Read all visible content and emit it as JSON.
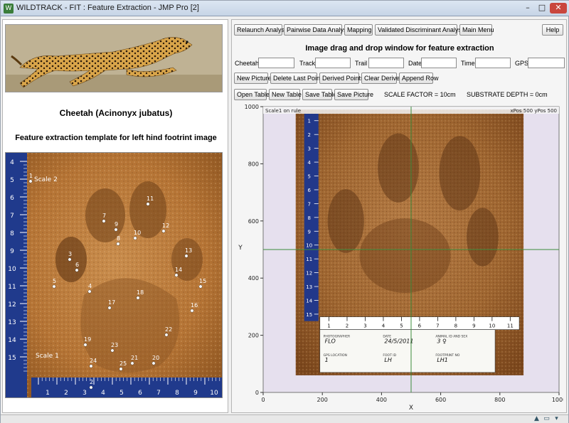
{
  "window": {
    "title": "WILDTRACK - FIT : Feature Extraction - JMP Pro [2]",
    "controls": {
      "minimize": "–",
      "maximize": "□",
      "close": "✕"
    }
  },
  "left_panel": {
    "species_title": "Cheetah (Acinonyx jubatus)",
    "template_title": "Feature extraction template for left hind footrint image",
    "scale_labels": {
      "scale2": "Scale 2",
      "scale1": "Scale 1"
    },
    "ruler_vertical": [
      "4",
      "5",
      "6",
      "7",
      "8",
      "9",
      "10",
      "11",
      "12",
      "13",
      "14",
      "15"
    ],
    "ruler_horizontal": [
      "1",
      "2",
      "3",
      "4",
      "5",
      "6",
      "7",
      "8",
      "9",
      "10"
    ],
    "point_labels": [
      "1",
      "2",
      "3",
      "4",
      "5",
      "6",
      "7",
      "8",
      "9",
      "10",
      "11",
      "12",
      "13",
      "14",
      "15",
      "16",
      "17",
      "18",
      "19",
      "20",
      "21",
      "22",
      "23",
      "24",
      "25"
    ]
  },
  "toolbar": {
    "relaunch": "Relaunch Analysis",
    "pairwise": "Pairwise Data Analysis",
    "mapping": "Mapping",
    "validated": "Validated Discriminant Analysis",
    "main_menu": "Main Menu",
    "help": "Help"
  },
  "dnd_title": "Image drag and drop window for feature extraction",
  "fields": {
    "cheetah": {
      "label": "Cheetah",
      "value": ""
    },
    "track": {
      "label": "Track",
      "value": ""
    },
    "trail": {
      "label": "Trail",
      "value": ""
    },
    "date": {
      "label": "Date",
      "value": ""
    },
    "time": {
      "label": "Time",
      "value": ""
    },
    "gps": {
      "label": "GPS",
      "value": ""
    }
  },
  "actions": {
    "new_picture": "New Picture",
    "delete_last_point": "Delete Last Point",
    "derived_points": "Derived Points",
    "clear_derived": "Clear Derived",
    "append_row": "Append Row"
  },
  "table_actions": {
    "open_table": "Open Table",
    "new_table": "New Table",
    "save_table": "Save Table",
    "save_picture": "Save Picture"
  },
  "scale_factor": "SCALE FACTOR = 10cm",
  "substrate_depth": "SUBSTRATE DEPTH = 0cm",
  "plot": {
    "overlay_left": "Scale1 on rule",
    "overlay_right": "xPos 500  yPos 500",
    "card": {
      "photographer_label": "PHOTOGRAPHER",
      "photographer": "FLO",
      "date_label": "DATE",
      "date": "24/5/2011",
      "animal_label": "ANIMAL ID AND SEX",
      "animal": "3 ♀",
      "gps_label": "GPS LOCATION",
      "gps": "1",
      "foot_label": "FOOT ID",
      "foot": "LH",
      "footprint_label": "FOOTPRINT NO",
      "footprint": "LH1"
    },
    "ruler_right": [
      "1",
      "2",
      "3",
      "4",
      "5",
      "6",
      "7",
      "8",
      "9",
      "10",
      "11",
      "12",
      "13",
      "14",
      "15"
    ],
    "ruler_bottom": [
      "1",
      "2",
      "3",
      "4",
      "5",
      "6",
      "7",
      "8",
      "9",
      "10",
      "11"
    ]
  },
  "chart_data": {
    "type": "scatter",
    "xlabel": "X",
    "ylabel": "Y",
    "xlim": [
      0,
      1000
    ],
    "ylim": [
      0,
      1000
    ],
    "x_ticks": [
      0,
      200,
      400,
      600,
      800,
      1000
    ],
    "y_ticks": [
      0,
      200,
      400,
      600,
      800,
      1000
    ],
    "crosshair": {
      "x": 500,
      "y": 500
    },
    "crosshair_color": "#3c8c3c",
    "image_extent": {
      "x": [
        110,
        880
      ],
      "y": [
        60,
        990
      ]
    },
    "background_color": "#e6e0ee"
  },
  "statusbar": {
    "icons": [
      "arrow-up-icon",
      "window-icon",
      "dropdown-icon"
    ]
  }
}
